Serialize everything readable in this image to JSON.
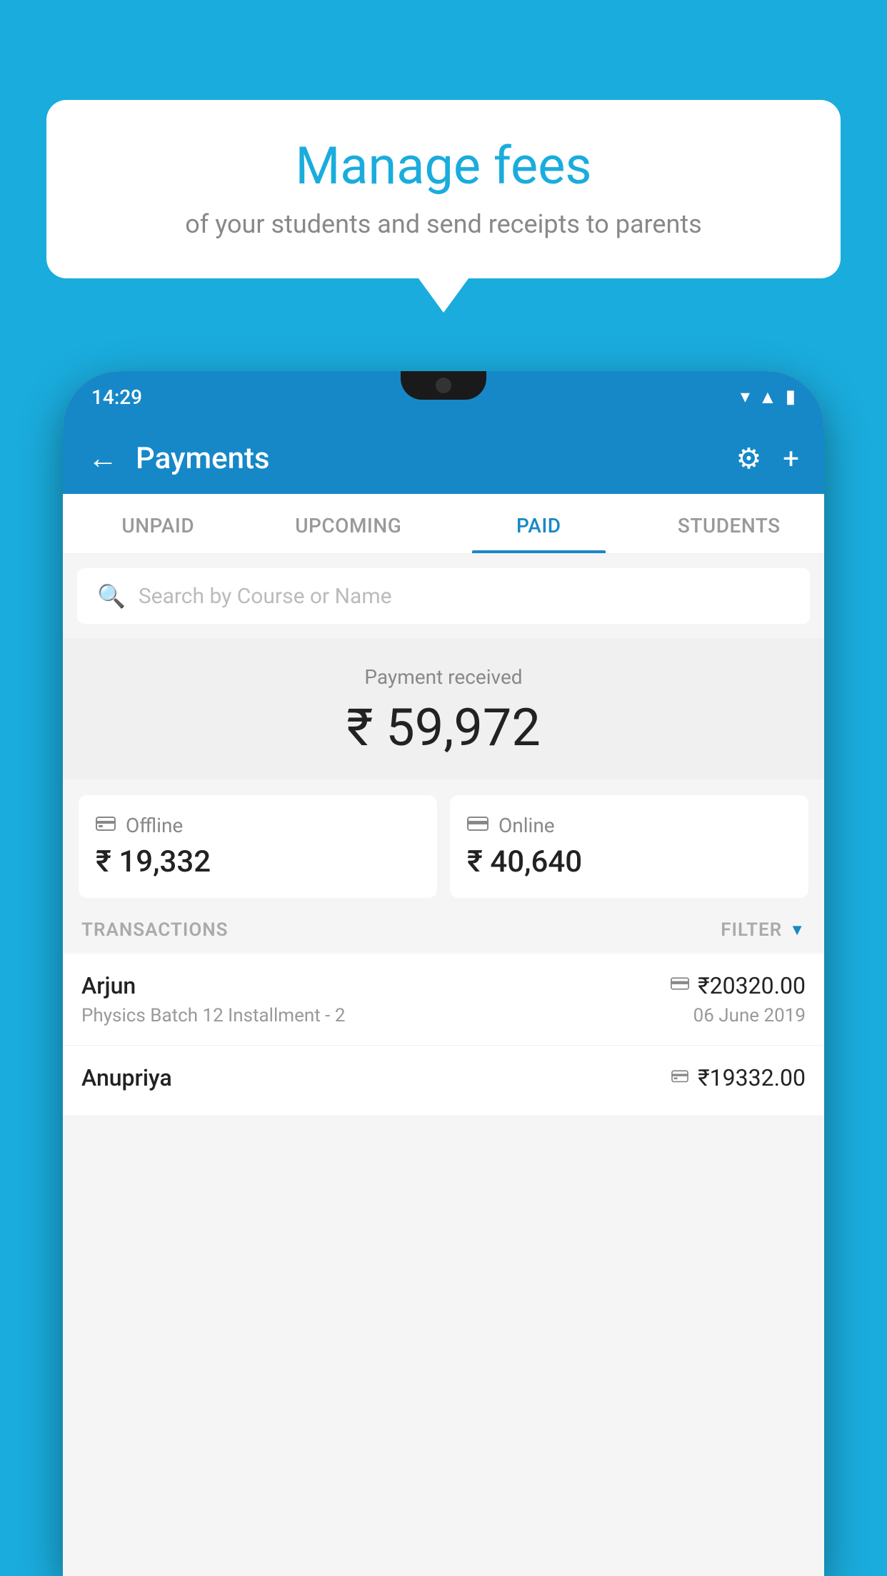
{
  "background": {
    "color": "#1AACDD"
  },
  "bubble": {
    "title": "Manage fees",
    "subtitle": "of your students and send receipts to parents"
  },
  "phone": {
    "status_bar": {
      "time": "14:29"
    },
    "header": {
      "title": "Payments",
      "back_label": "←",
      "settings_label": "⚙",
      "add_label": "+"
    },
    "tabs": [
      {
        "id": "unpaid",
        "label": "UNPAID",
        "active": false
      },
      {
        "id": "upcoming",
        "label": "UPCOMING",
        "active": false
      },
      {
        "id": "paid",
        "label": "PAID",
        "active": true
      },
      {
        "id": "students",
        "label": "STUDENTS",
        "active": false
      }
    ],
    "search": {
      "placeholder": "Search by Course or Name"
    },
    "payment_summary": {
      "label": "Payment received",
      "amount": "₹ 59,972"
    },
    "cards": [
      {
        "id": "offline",
        "type": "Offline",
        "amount": "₹ 19,332",
        "icon": "💴"
      },
      {
        "id": "online",
        "type": "Online",
        "amount": "₹ 40,640",
        "icon": "💳"
      }
    ],
    "transactions": {
      "header_label": "TRANSACTIONS",
      "filter_label": "FILTER"
    },
    "transaction_rows": [
      {
        "id": "arjun",
        "name": "Arjun",
        "amount": "₹20320.00",
        "course": "Physics Batch 12 Installment - 2",
        "date": "06 June 2019",
        "icon": "💳"
      },
      {
        "id": "anupriya",
        "name": "Anupriya",
        "amount": "₹19332.00",
        "course": "",
        "date": "",
        "icon": "💴"
      }
    ]
  }
}
